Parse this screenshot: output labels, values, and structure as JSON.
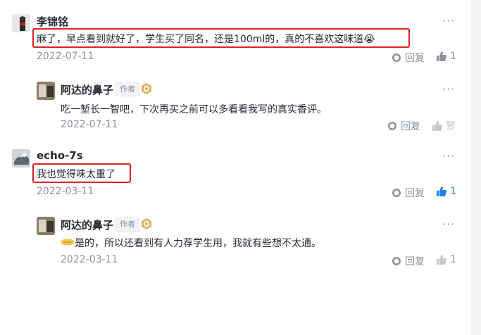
{
  "comments": [
    {
      "author": "李锦铭",
      "text": "麻了，早点看到就好了，学生买了同名，还是100ml的，真的不喜欢这味道😭",
      "date": "2022-07-11",
      "reply_label": "回复",
      "like_count": "1",
      "more": "···",
      "reply": {
        "author": "阿达的鼻子",
        "author_tag": "作者",
        "text": "吃一堑长一智吧，下次再买之前可以多看看我写的真实香评。",
        "date": "2022-07-11",
        "reply_label": "回复",
        "like_label": "赞",
        "more": "···"
      }
    },
    {
      "author": "echo-7s",
      "text": "我也觉得味太重了",
      "date": "2022-03-11",
      "reply_label": "回复",
      "like_count": "1",
      "more": "···",
      "reply": {
        "author": "阿达的鼻子",
        "author_tag": "作者",
        "text": "是的，所以还看到有人力荐学生用，我就有些想不太通。",
        "date": "2022-03-11",
        "reply_label": "回复",
        "like_count": "1",
        "more": "···"
      }
    }
  ],
  "colors": {
    "highlight": "#e02020",
    "like_active": "#1e80ff",
    "muted": "#8a919f"
  }
}
